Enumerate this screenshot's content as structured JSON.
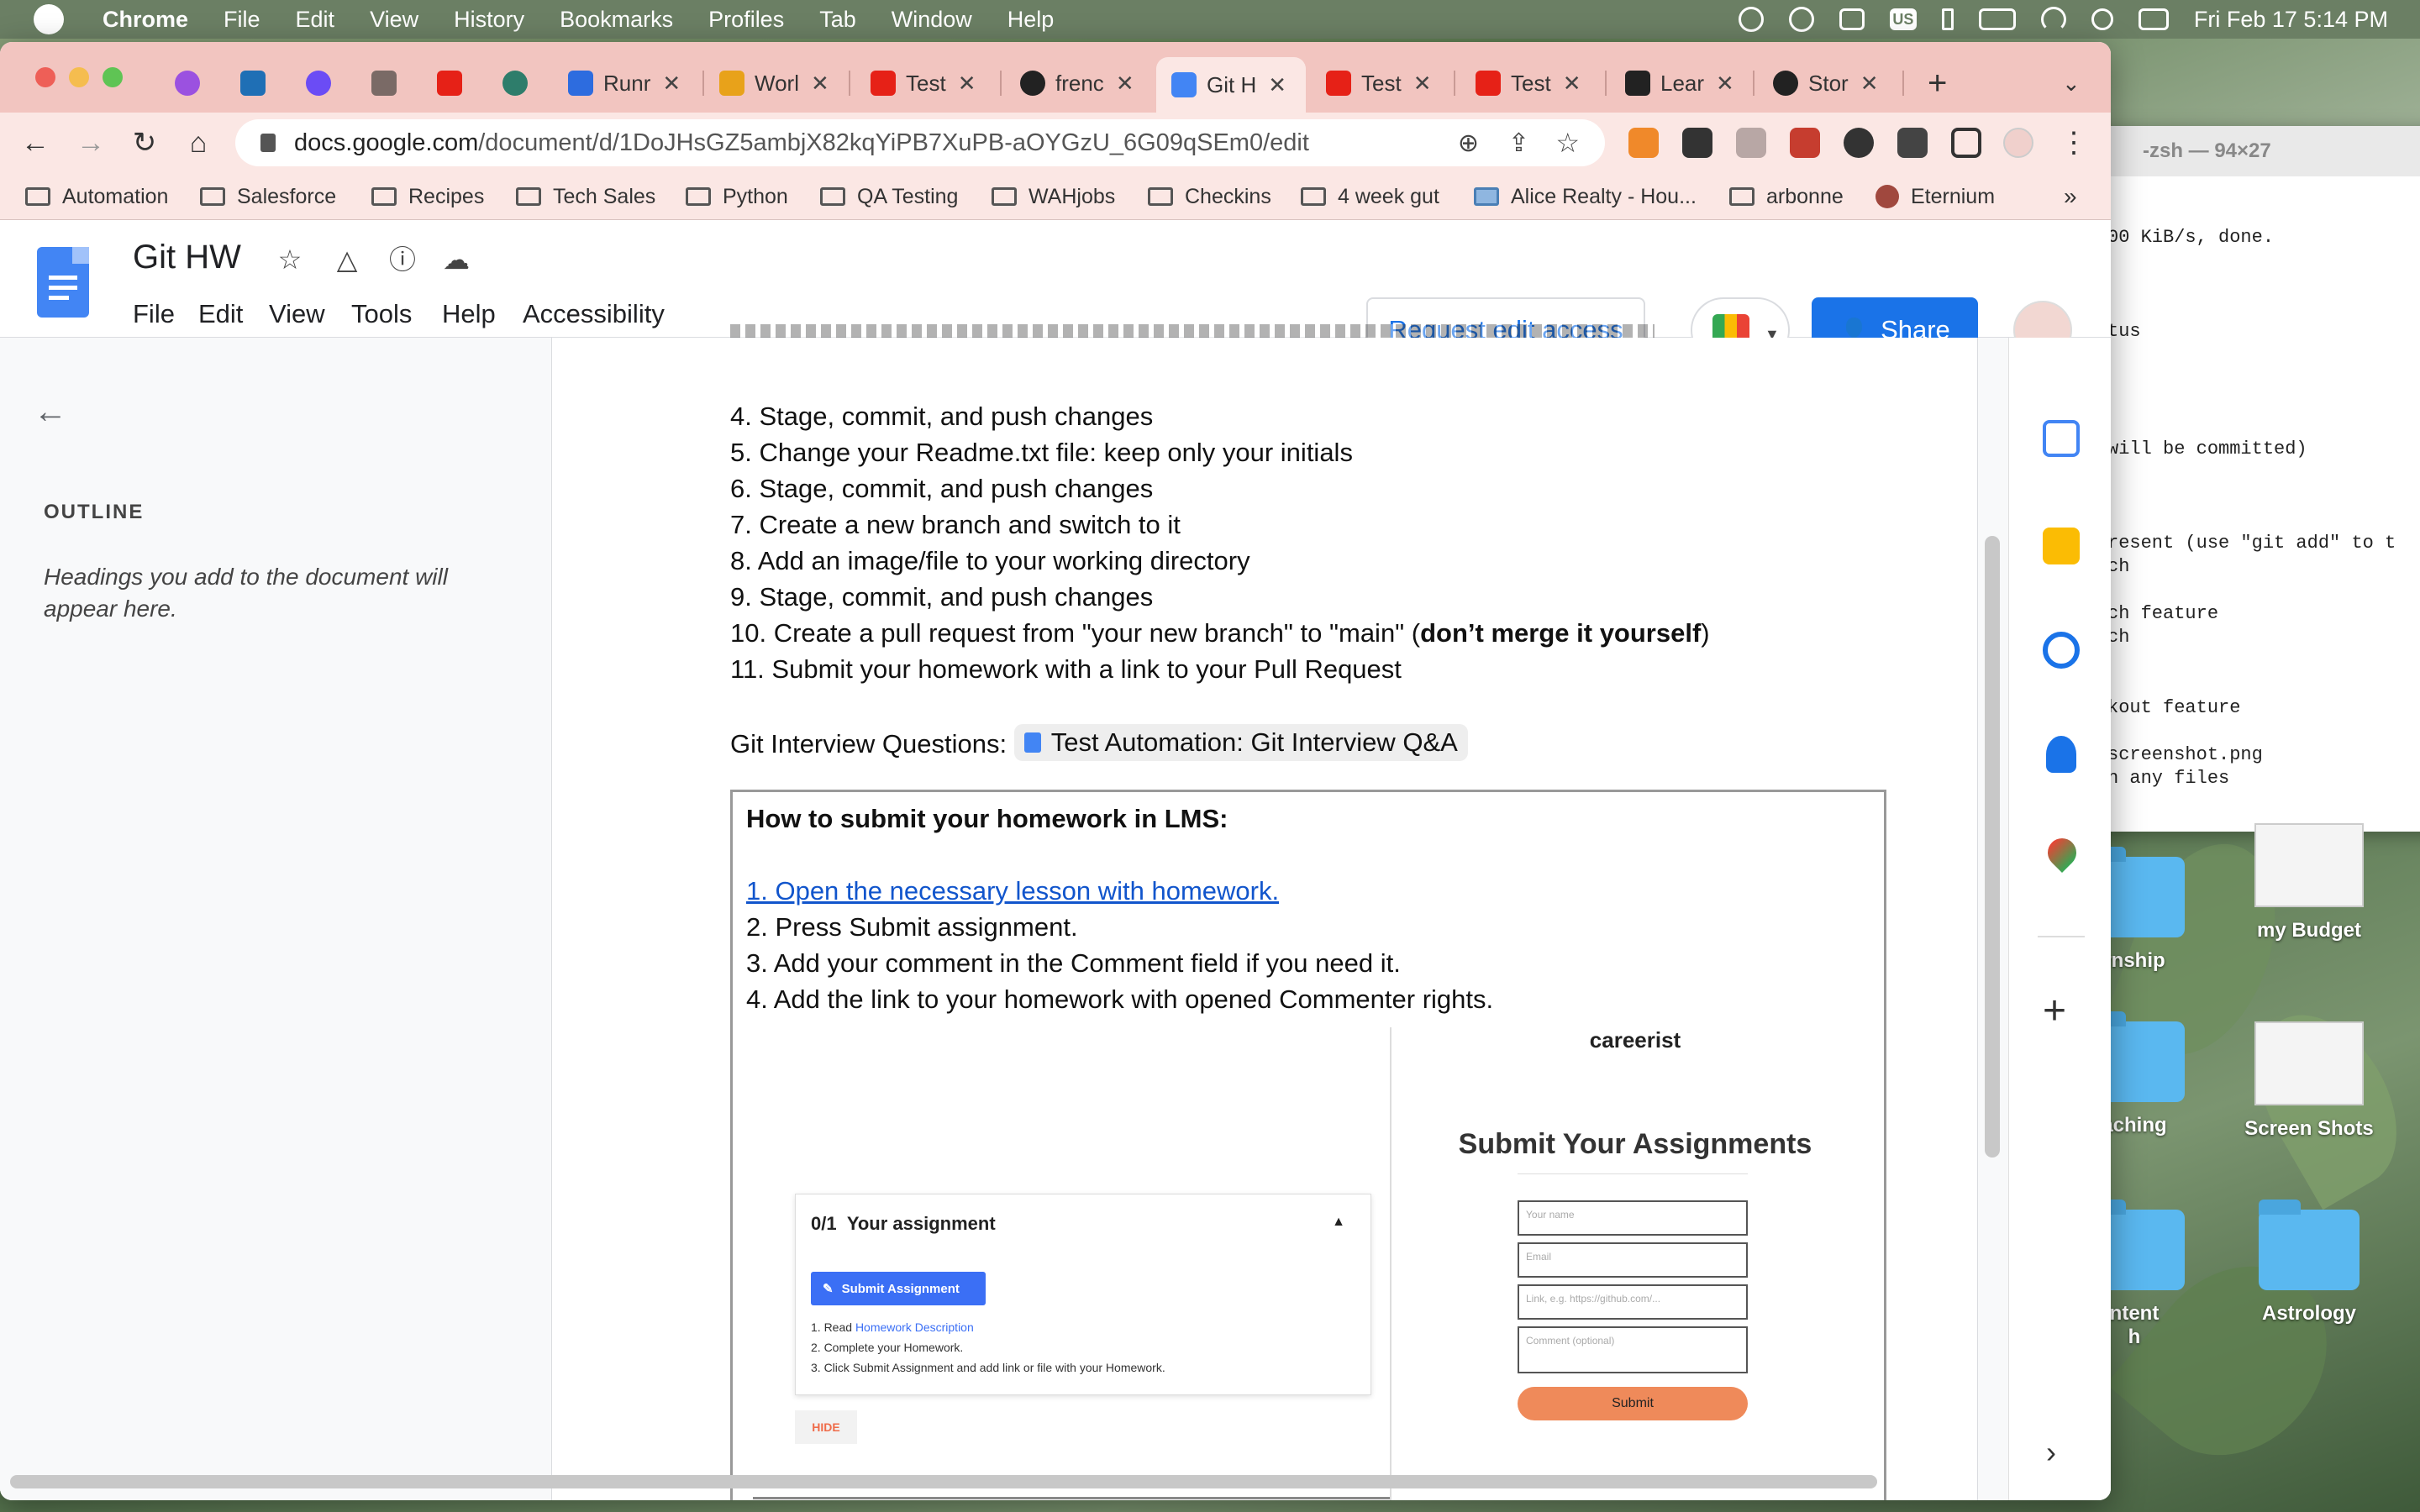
{
  "menubar": {
    "app": "Chrome",
    "items": [
      "File",
      "Edit",
      "View",
      "History",
      "Bookmarks",
      "Profiles",
      "Tab",
      "Window",
      "Help"
    ],
    "input_source": "US",
    "datetime": "Fri Feb 17  5:14 PM"
  },
  "tabs": [
    {
      "label": "Runr",
      "icon": "r-icon"
    },
    {
      "label": "Worl",
      "icon": "w-icon"
    },
    {
      "label": "Test",
      "icon": "youtube-icon"
    },
    {
      "label": "frenc",
      "icon": "github-icon"
    },
    {
      "label": "Git H",
      "icon": "docs-icon",
      "active": true
    },
    {
      "label": "Test",
      "icon": "youtube-icon"
    },
    {
      "label": "Test",
      "icon": "youtube-icon"
    },
    {
      "label": "Lear",
      "icon": "learn-icon"
    },
    {
      "label": "Stor",
      "icon": "github-icon"
    }
  ],
  "omnibox": {
    "host": "docs.google.com",
    "path": "/document/d/1DoJHsGZ5ambjX82kqYiPB7XuPB-aOYGzU_6G09qSEm0/edit"
  },
  "bookmarks": [
    "Automation",
    "Salesforce",
    "Recipes",
    "Tech Sales",
    "Python",
    "QA Testing",
    "WAHjobs",
    "Checkins",
    "4 week gut",
    "Alice Realty - Hou...",
    "arbonne",
    "Eternium"
  ],
  "docs": {
    "title": "Git HW",
    "menu": [
      "File",
      "Edit",
      "View",
      "Tools",
      "Help",
      "Accessibility"
    ],
    "request_edit": "Request edit access",
    "share": "Share"
  },
  "outline": {
    "heading": "OUTLINE",
    "empty_text": "Headings you add to the document will appear here."
  },
  "document": {
    "steps": [
      "4. Stage, commit, and push changes",
      "5. Change your Readme.txt file: keep only your initials",
      "6. Stage, commit, and push changes",
      "7. Create a new branch and switch to it",
      "8. Add an image/file to your working directory",
      "9. Stage, commit, and push changes",
      "10. Create a pull request from \"your new branch\" to \"main\" (",
      "11. Submit your homework with a link to your Pull Request"
    ],
    "step10_bold": "don’t merge it yourself",
    "step10_end": ")",
    "interview_label": "Git Interview Questions:",
    "interview_chip": "Test Automation: Git Interview Q&A",
    "box_title": "How to submit your homework in LMS:",
    "box_link": "1. Open the necessary lesson with homework.",
    "box_steps": [
      "2. Press Submit assignment.",
      "3. Add your comment in the Comment field if you need it.",
      "4. Add the link to your homework with opened Commenter rights."
    ]
  },
  "embed_left": {
    "counter": "0/1",
    "heading": "Your assignment",
    "button": "Submit Assignment",
    "line1_pre": "1. Read ",
    "line1_link": "Homework Description",
    "line2": "2. Complete your Homework.",
    "line3": "3. Click Submit Assignment and add link or file with your Homework.",
    "hide": "HIDE"
  },
  "embed_right": {
    "brand": "careerist",
    "title": "Submit Your Assignments",
    "placeholders": [
      "Your name",
      "Email",
      "Link, e.g. https://github.com/...",
      "Comment (optional)"
    ],
    "submit": "Submit"
  },
  "terminal": {
    "title": "-zsh — 94×27",
    "lines": [
      "00 KiB/s, done.",
      "tus",
      " will be committed)",
      "resent (use \"git add\" to t",
      "ch",
      "ch feature",
      "ch",
      "kout feature",
      "screenshot.png",
      "h any files"
    ]
  },
  "desktop_icons": [
    {
      "label": "rnship"
    },
    {
      "label": "my Budget"
    },
    {
      "label": "aching"
    },
    {
      "label": "Screen Shots"
    },
    {
      "label": "ntent"
    },
    {
      "label": "h"
    },
    {
      "label": "Astrology"
    }
  ],
  "colors": {
    "tabbar": "#f2c5c0",
    "toolbar": "#fbe7e4",
    "accent": "#1a73e8",
    "submit": "#ef8a5a"
  }
}
